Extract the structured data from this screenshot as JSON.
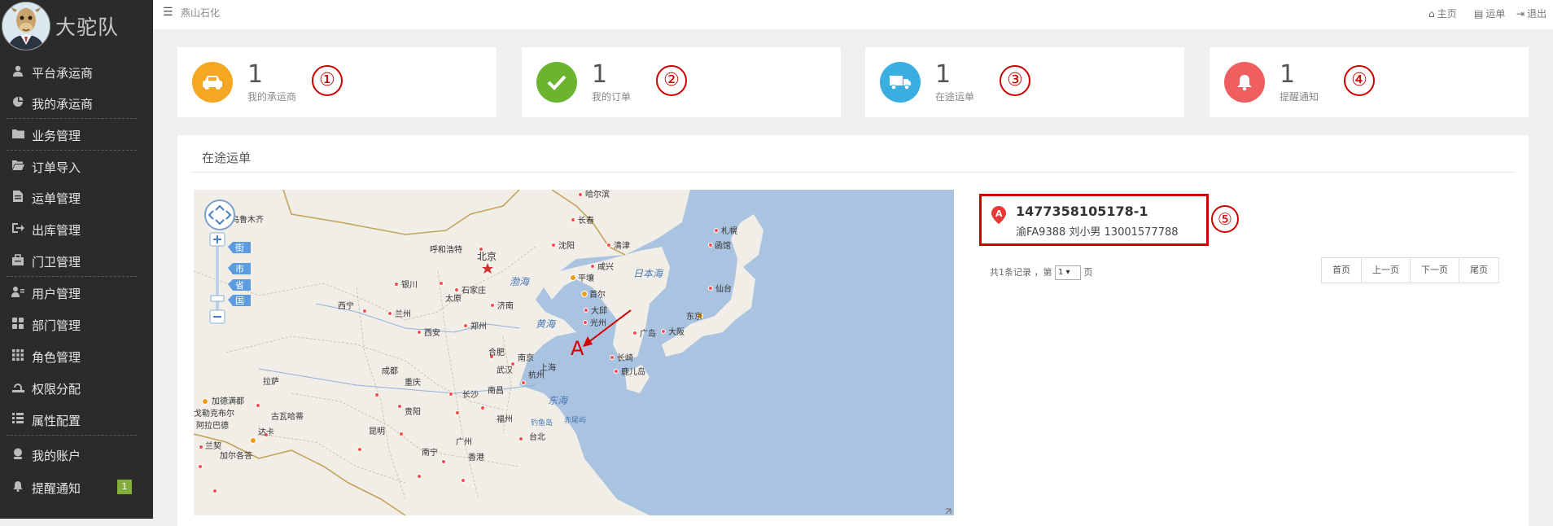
{
  "sidebar": {
    "brand": "大驼队",
    "items": [
      {
        "label": "平台承运商",
        "icon": "user-icon"
      },
      {
        "label": "我的承运商",
        "icon": "pie-chart-icon"
      },
      {
        "label": "业务管理",
        "icon": "folder-icon"
      },
      {
        "label": "订单导入",
        "icon": "folder-open-icon"
      },
      {
        "label": "运单管理",
        "icon": "document-icon"
      },
      {
        "label": "出库管理",
        "icon": "sign-out-icon"
      },
      {
        "label": "门卫管理",
        "icon": "briefcase-icon"
      },
      {
        "label": "用户管理",
        "icon": "users-icon"
      },
      {
        "label": "部门管理",
        "icon": "grid-icon"
      },
      {
        "label": "角色管理",
        "icon": "dots-grid-icon"
      },
      {
        "label": "权限分配",
        "icon": "key-icon"
      },
      {
        "label": "属性配置",
        "icon": "list-icon"
      },
      {
        "label": "我的账户",
        "icon": "account-icon"
      },
      {
        "label": "提醒通知",
        "icon": "bell-icon",
        "badge": "1"
      }
    ]
  },
  "topbar": {
    "company": "燕山石化",
    "links": [
      {
        "label": "主页",
        "icon": "home-icon"
      },
      {
        "label": "运单",
        "icon": "file-icon"
      },
      {
        "label": "退出",
        "icon": "logout-icon"
      }
    ]
  },
  "cards": [
    {
      "count": "1",
      "label": "我的承运商",
      "marker": "①",
      "icon": "car-icon",
      "color": "#f5a623"
    },
    {
      "count": "1",
      "label": "我的订单",
      "marker": "②",
      "icon": "check-icon",
      "color": "#6bb42f"
    },
    {
      "count": "1",
      "label": "在途运单",
      "marker": "③",
      "icon": "truck-icon",
      "color": "#3aaee0"
    },
    {
      "count": "1",
      "label": "提醒通知",
      "marker": "④",
      "icon": "bell-icon",
      "color": "#ef5f5f"
    }
  ],
  "panel": {
    "title": "在途运单",
    "map": {
      "zoom_levels": [
        "街",
        "市",
        "省",
        "国"
      ],
      "marker_letter": "A",
      "labels": {
        "harbin": "哈尔滨",
        "urumqi": "乌鲁木齐",
        "changchun": "长春",
        "hohhot": "呼和浩特",
        "shenyang": "沈阳",
        "qingjin": "清津",
        "beijing": "北京",
        "sapporo": "札幌",
        "hakodate": "函馆",
        "bohai": "渤海",
        "pingrang": "平壤",
        "xianxing": "咸兴",
        "yinchuan": "银川",
        "shijiazhuang": "石家庄",
        "japan_sea": "日本海",
        "shouer": "首尔",
        "taiyuan": "太原",
        "xining": "西宁",
        "jinan": "济南",
        "lanzhou": "兰州",
        "daqiu": "大邱",
        "sendai": "仙台",
        "guangzhou_kr": "光州",
        "huanghai": "黄海",
        "tokyo": "东京",
        "zhengzhou": "郑州",
        "xian": "西安",
        "hiroshima": "广岛",
        "osaka": "大阪",
        "hefei": "合肥",
        "nanjing": "南京",
        "nagasaki": "长崎",
        "shanghai": "上海",
        "kagoshima": "鹿儿岛",
        "wuhan": "武汉",
        "hangzhou": "杭州",
        "chengdu": "成都",
        "lhasa": "拉萨",
        "chongqing": "重庆",
        "changsha": "长沙",
        "nanchang": "南昌",
        "donghai": "东海",
        "kathmandu": "加德满都",
        "dhaka": "达卡",
        "guiyang": "贵阳",
        "fuzhou": "福州",
        "diaoyudao": "钓鱼岛",
        "chiweiyu": "赤尾屿",
        "kolkata": "加尔各答",
        "kunming": "昆明",
        "taipei": "台北",
        "nanning": "南宁",
        "guangzhou": "广州",
        "hongkong": "香港",
        "gorakhpur": "戈勒克布尔",
        "allahabad": "阿拉巴德",
        "ranchi": "兰契",
        "guwahati": "古瓦哈蒂"
      }
    },
    "result": {
      "id": "1477358105178-1",
      "info": "渝FA9388 刘小男 13001577788",
      "marker": "⑤"
    },
    "pager": {
      "summary_prefix": "共1条记录 ，第",
      "page": "1",
      "summary_suffix": "页",
      "buttons": [
        "首页",
        "上一页",
        "下一页",
        "尾页"
      ]
    }
  }
}
